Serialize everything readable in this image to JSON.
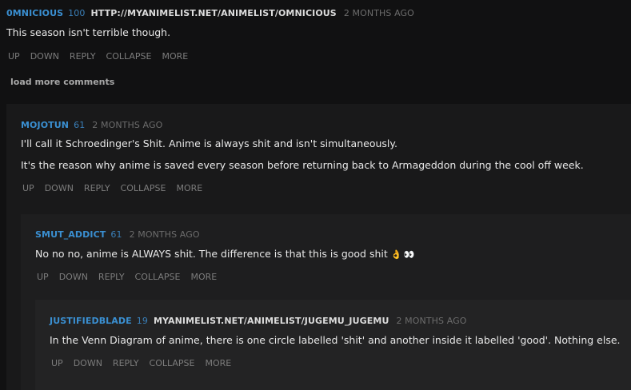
{
  "comments": {
    "omnicious": {
      "user": "0MNICIOUS",
      "score": "100",
      "flair": "HTTP://MYANIMELIST.NET/ANIMELIST/OMNICIOUS",
      "time": "2 MONTHS AGO",
      "body": "This season isn't terrible though."
    },
    "mojotun": {
      "user": "MOJOTUN",
      "score": "61",
      "time": "2 MONTHS AGO",
      "body1": "I'll call it Schroedinger's Shit. Anime is always shit and isn't simultaneously.",
      "body2": "It's the reason why anime is saved every season before returning back to Armageddon during the cool off week."
    },
    "smut": {
      "user": "SMUT_ADDICT",
      "score": "61",
      "time": "2 MONTHS AGO",
      "body": "No no no, anime is ALWAYS shit. The difference is that this is good shit",
      "emoji1": "👌",
      "emoji2": "👀"
    },
    "justified": {
      "user": "JUSTIFIEDBLADE",
      "score": "19",
      "flair": "MYANIMELIST.NET/ANIMELIST/JUGEMU_JUGEMU",
      "time": "2 MONTHS AGO",
      "body": "In the Venn Diagram of anime, there is one circle labelled 'shit' and another inside it labelled 'good'. Nothing else."
    }
  },
  "actions": {
    "up": "UP",
    "down": "DOWN",
    "reply": "REPLY",
    "collapse": "COLLAPSE",
    "more": "MORE"
  },
  "load_more": "load more comments",
  "colors": {
    "username": "#3a8fd1",
    "background": "#111112"
  }
}
